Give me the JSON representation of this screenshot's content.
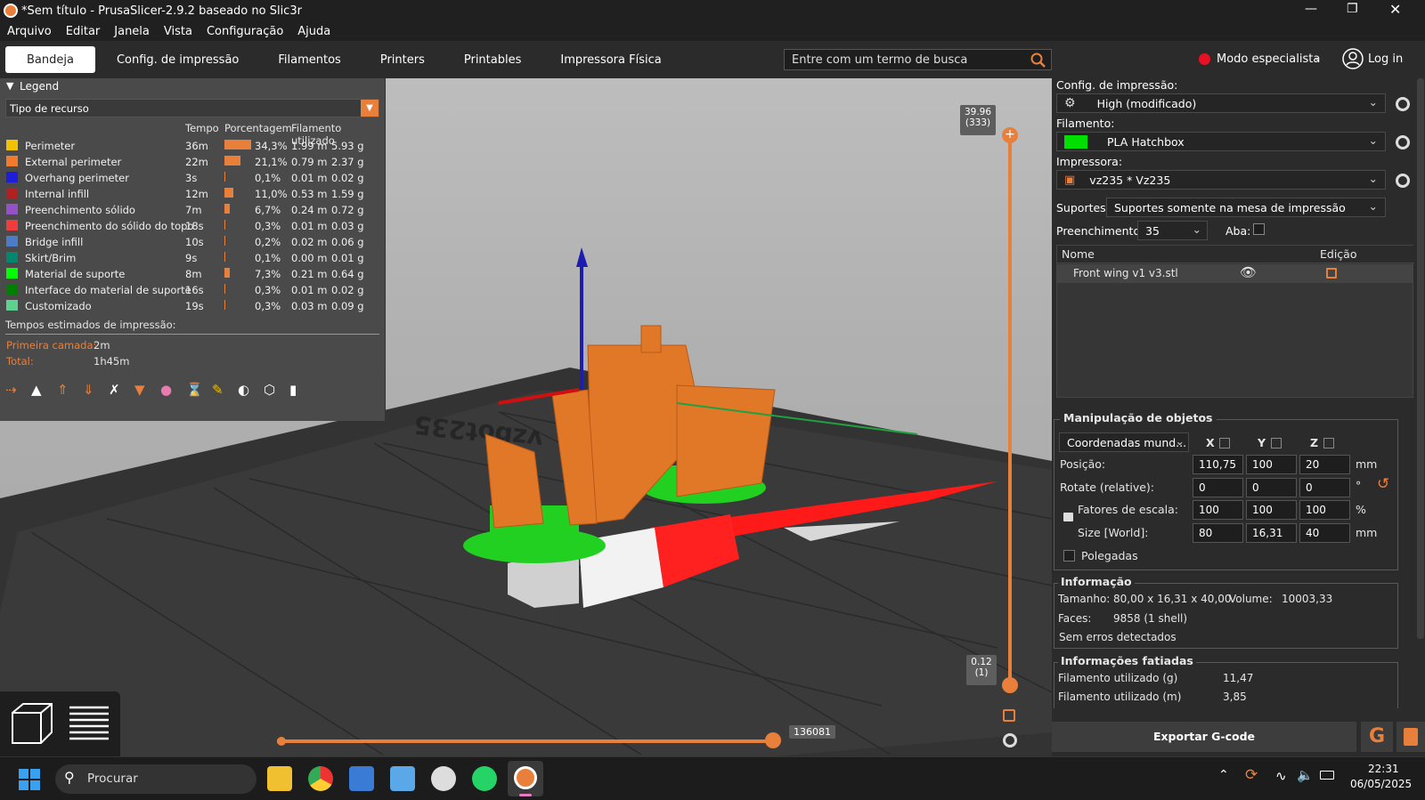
{
  "window": {
    "title": "*Sem título - PrusaSlicer-2.9.2 baseado no Slic3r"
  },
  "menu": [
    "Arquivo",
    "Editar",
    "Janela",
    "Vista",
    "Configuração",
    "Ajuda"
  ],
  "tabs": [
    "Bandeja",
    "Config. de impressão",
    "Filamentos",
    "Printers",
    "Printables",
    "Impressora Física"
  ],
  "search": {
    "placeholder": "Entre com um termo de busca"
  },
  "mode": {
    "label": "Modo especialista",
    "login": "Log in",
    "dot_color": "#e81123"
  },
  "legend": {
    "title": "Legend",
    "view_type": "Tipo de recurso",
    "headers": {
      "time": "Tempo",
      "percent": "Porcentagem",
      "filament": "Filamento utilizado"
    },
    "rows": [
      {
        "name": "Perimeter",
        "color": "#f2c200",
        "time": "36m",
        "percent": "34,3%",
        "pct_value": 34.3,
        "m": "1.99 m",
        "g": "5.93 g"
      },
      {
        "name": "External perimeter",
        "color": "#f07b2c",
        "time": "22m",
        "percent": "21,1%",
        "pct_value": 21.1,
        "m": "0.79 m",
        "g": "2.37 g"
      },
      {
        "name": "Overhang perimeter",
        "color": "#1d1ddb",
        "time": "3s",
        "percent": "0,1%",
        "pct_value": 0.1,
        "m": "0.01 m",
        "g": "0.02 g"
      },
      {
        "name": "Internal infill",
        "color": "#b02222",
        "time": "12m",
        "percent": "11,0%",
        "pct_value": 11.0,
        "m": "0.53 m",
        "g": "1.59 g"
      },
      {
        "name": "Preenchimento sólido",
        "color": "#9650c8",
        "time": "7m",
        "percent": "6,7%",
        "pct_value": 6.7,
        "m": "0.24 m",
        "g": "0.72 g"
      },
      {
        "name": "Preenchimento do sólido do topo",
        "color": "#f03c3c",
        "time": "18s",
        "percent": "0,3%",
        "pct_value": 0.3,
        "m": "0.01 m",
        "g": "0.03 g"
      },
      {
        "name": "Bridge infill",
        "color": "#4a7cc8",
        "time": "10s",
        "percent": "0,2%",
        "pct_value": 0.2,
        "m": "0.02 m",
        "g": "0.06 g"
      },
      {
        "name": "Skirt/Brim",
        "color": "#00876e",
        "time": "9s",
        "percent": "0,1%",
        "pct_value": 0.1,
        "m": "0.00 m",
        "g": "0.01 g"
      },
      {
        "name": "Material de suporte",
        "color": "#00ff00",
        "time": "8m",
        "percent": "7,3%",
        "pct_value": 7.3,
        "m": "0.21 m",
        "g": "0.64 g"
      },
      {
        "name": "Interface do material de suporte",
        "color": "#008000",
        "time": "16s",
        "percent": "0,3%",
        "pct_value": 0.3,
        "m": "0.01 m",
        "g": "0.02 g"
      },
      {
        "name": "Customizado",
        "color": "#5ed18f",
        "time": "19s",
        "percent": "0,3%",
        "pct_value": 0.3,
        "m": "0.03 m",
        "g": "0.09 g"
      }
    ],
    "estimates_title": "Tempos estimados de impressão:",
    "first_layer_label": "Primeira camada:",
    "first_layer_value": "2m",
    "total_label": "Total:",
    "total_value": "1h45m"
  },
  "viewport": {
    "slider_top": {
      "value": "39.96",
      "layer": "(333)"
    },
    "slider_bottom": {
      "value": "0.12",
      "layer": "(1)"
    },
    "horizontal_value": "136081",
    "bed_text": "vzbot235"
  },
  "right": {
    "print_label": "Config. de impressão:",
    "print_value": "High (modificado)",
    "filament_label": "Filamento:",
    "filament_value": "PLA Hatchbox",
    "filament_color": "#00e000",
    "printer_label": "Impressora:",
    "printer_value": "vz235 * Vz235",
    "supports_label": "Suportes:",
    "supports_value": "Suportes somente na mesa de impressão",
    "infill_label": "Preenchimento:",
    "infill_value": "35",
    "brim_label": "Aba:",
    "list_headers": {
      "name": "Nome",
      "edit": "Edição"
    },
    "object_name": "Front wing v1 v3.stl",
    "manip_title": "Manipulação de objetos",
    "coord_value": "Coordenadas mund...",
    "axes": [
      "X",
      "Y",
      "Z"
    ],
    "position_label": "Posição:",
    "position": [
      "110,75",
      "100",
      "20"
    ],
    "position_unit": "mm",
    "rotate_label": "Rotate (relative):",
    "rotate": [
      "0",
      "0",
      "0"
    ],
    "rotate_unit": "°",
    "scale_label": "Fatores de escala:",
    "scale": [
      "100",
      "100",
      "100"
    ],
    "scale_unit": "%",
    "size_label": "Size [World]:",
    "size": [
      "80",
      "16,31",
      "40"
    ],
    "size_unit": "mm",
    "inches_label": "Polegadas",
    "info_title": "Informação",
    "size_info_label": "Tamanho:",
    "size_info_value": "80,00 x 16,31 x 40,00",
    "volume_label": "Volume:",
    "volume_value": "10003,33",
    "faces_label": "Faces:",
    "faces_value": "9858 (1 shell)",
    "errors_text": "Sem erros detectados",
    "sliced_title": "Informações fatiadas",
    "fil_g_label": "Filamento utilizado (g)",
    "fil_g_value": "11,47",
    "fil_m_label": "Filamento utilizado (m)",
    "fil_m_value": "3,85",
    "export_label": "Exportar G-code"
  },
  "taskbar": {
    "search_label": "Procurar",
    "time": "22:31",
    "date": "06/05/2025"
  }
}
